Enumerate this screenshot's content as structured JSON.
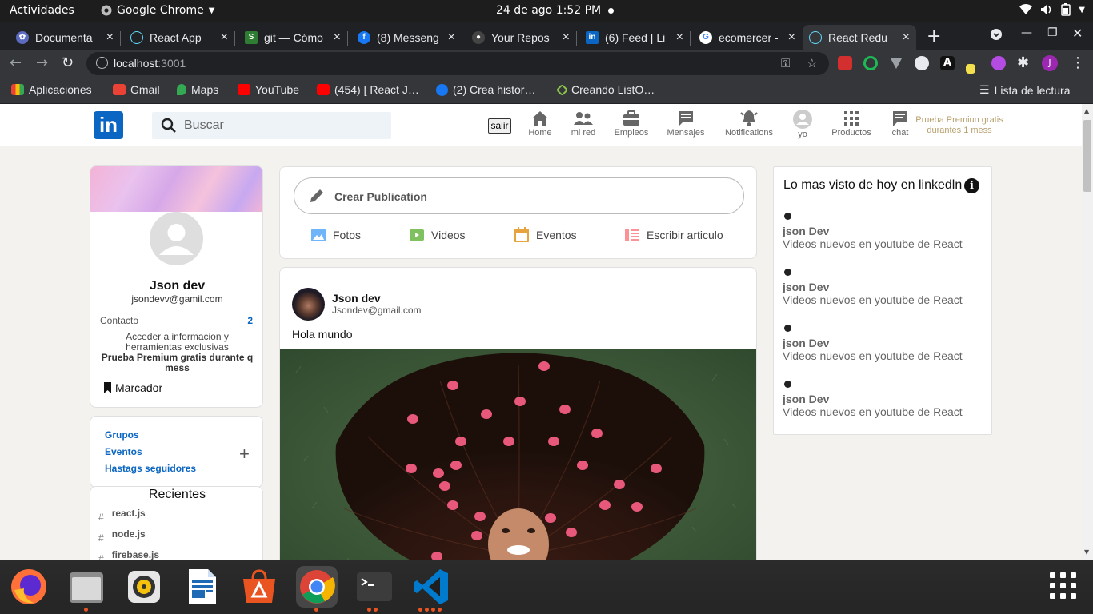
{
  "system_bar": {
    "activities": "Actividades",
    "app_name": "Google Chrome",
    "clock": "24 de ago  1:52 PM"
  },
  "tabs": [
    {
      "title": "Documenta",
      "icon": "app-icon"
    },
    {
      "title": "React App",
      "icon": "react-icon"
    },
    {
      "title": "git — Cómo",
      "icon": "stackoverflow-icon"
    },
    {
      "title": "(8) Messeng",
      "icon": "facebook-icon"
    },
    {
      "title": "Your Repos",
      "icon": "github-icon"
    },
    {
      "title": "(6) Feed | Li",
      "icon": "linkedin-icon"
    },
    {
      "title": "ecomercer -",
      "icon": "google-icon"
    },
    {
      "title": "React Redu",
      "icon": "react-icon",
      "active": true
    }
  ],
  "omnibox": {
    "host": "localhost",
    "port": ":3001"
  },
  "bookmarks": [
    {
      "label": "Aplicaciones",
      "color": "#e8eaed"
    },
    {
      "label": "Gmail",
      "color": "#ea4335"
    },
    {
      "label": "Maps",
      "color": "#34a853"
    },
    {
      "label": "YouTube",
      "color": "#ff0000"
    },
    {
      "label": "(454) [ React J…",
      "color": "#ff0000"
    },
    {
      "label": "(2) Crea histor…",
      "color": "#1877f2"
    },
    {
      "label": "Creando ListO…",
      "color": "#8bc34a"
    }
  ],
  "reading_list": "Lista de lectura",
  "header": {
    "logo": "in",
    "search_placeholder": "Buscar",
    "logout": "salir",
    "nav": [
      {
        "label": "Home",
        "icon": "home-icon"
      },
      {
        "label": "mi red",
        "icon": "network-icon"
      },
      {
        "label": "Empleos",
        "icon": "briefcase-icon"
      },
      {
        "label": "Mensajes",
        "icon": "messages-icon"
      },
      {
        "label": "Notifications",
        "icon": "bell-icon"
      },
      {
        "label": "yo",
        "icon": "avatar-icon"
      },
      {
        "label": "Productos",
        "icon": "apps-grid-icon"
      },
      {
        "label": "chat",
        "icon": "chat-icon"
      }
    ],
    "premium": "Prueba Premiun gratis durantes 1 mess"
  },
  "profile": {
    "name": "Json dev",
    "email": "jsondevv@gamil.com",
    "contact_label": "Contacto",
    "contact_count": "2",
    "access_text": "Acceder a informacion y herramientas exclusivas",
    "premium_text": "Prueba Premium gratis durante q mess",
    "bookmark_label": "Marcador"
  },
  "groups": {
    "items": [
      "Grupos",
      "Eventos",
      "Hastags seguidores"
    ]
  },
  "recent": {
    "title": "Recientes",
    "items": [
      "react.js",
      "node.js",
      "firebase.js"
    ]
  },
  "share": {
    "placeholder": "Crear Publication",
    "actions": [
      {
        "label": "Fotos",
        "icon": "photo-icon",
        "color": "#70b5f9"
      },
      {
        "label": "Videos",
        "icon": "video-icon",
        "color": "#7fc15e"
      },
      {
        "label": "Eventos",
        "icon": "calendar-icon",
        "color": "#e7a33e"
      },
      {
        "label": "Escribir articulo",
        "icon": "article-icon",
        "color": "#fc9295"
      }
    ]
  },
  "post": {
    "author": "Json dev",
    "email": "Jsondev@gmail.com",
    "text": "Hola mundo"
  },
  "news": {
    "title": "Lo mas visto de hoy en linkedln",
    "items": [
      {
        "author": "json Dev",
        "desc": "Videos nuevos en youtube de React"
      },
      {
        "author": "json Dev",
        "desc": "Videos nuevos en youtube de React"
      },
      {
        "author": "json Dev",
        "desc": "Videos nuevos en youtube de React"
      },
      {
        "author": "json Dev",
        "desc": "Videos nuevos en youtube de React"
      }
    ]
  },
  "dock": [
    {
      "app": "firefox-icon"
    },
    {
      "app": "files-icon"
    },
    {
      "app": "rhythmbox-icon"
    },
    {
      "app": "writer-icon"
    },
    {
      "app": "software-icon"
    },
    {
      "app": "chrome-icon"
    },
    {
      "app": "terminal-icon"
    },
    {
      "app": "vscode-icon"
    }
  ]
}
